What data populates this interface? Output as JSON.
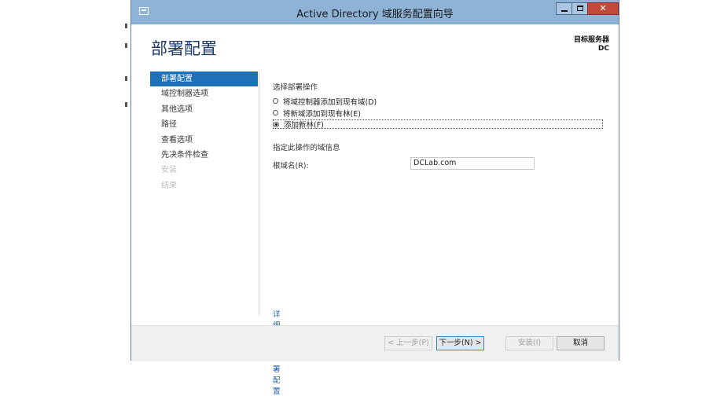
{
  "window": {
    "title": "Active Directory 域服务配置向导"
  },
  "page": {
    "title": "部署配置",
    "target_server_label": "目标服务器",
    "target_server_name": "DC"
  },
  "sidebar": {
    "items": [
      {
        "label": "部署配置",
        "state": "active"
      },
      {
        "label": "域控制器选项",
        "state": "normal"
      },
      {
        "label": "其他选项",
        "state": "normal"
      },
      {
        "label": "路径",
        "state": "normal"
      },
      {
        "label": "查看选项",
        "state": "normal"
      },
      {
        "label": "先决条件检查",
        "state": "normal"
      },
      {
        "label": "安装",
        "state": "disabled"
      },
      {
        "label": "结果",
        "state": "disabled"
      }
    ]
  },
  "content": {
    "section_title": "选择部署操作",
    "options": [
      {
        "label": "将域控制器添加到现有域(D)",
        "selected": false
      },
      {
        "label": "将新域添加到现有林(E)",
        "selected": false
      },
      {
        "label": "添加新林(F)",
        "selected": true
      }
    ],
    "domain_info_title": "指定此操作的域信息",
    "root_domain_label": "根域名(R):",
    "root_domain_value": "DCLab.com",
    "more_link": "详细了解 部署配置"
  },
  "footer": {
    "prev_label": "< 上一步(P)",
    "next_label": "下一步(N) >",
    "install_label": "安装(I)",
    "cancel_label": "取消"
  },
  "colors": {
    "titlebar": "#8fb3d6",
    "accent": "#1c71b8",
    "title_text": "#1b3a6b",
    "close_button": "#c4483c"
  }
}
